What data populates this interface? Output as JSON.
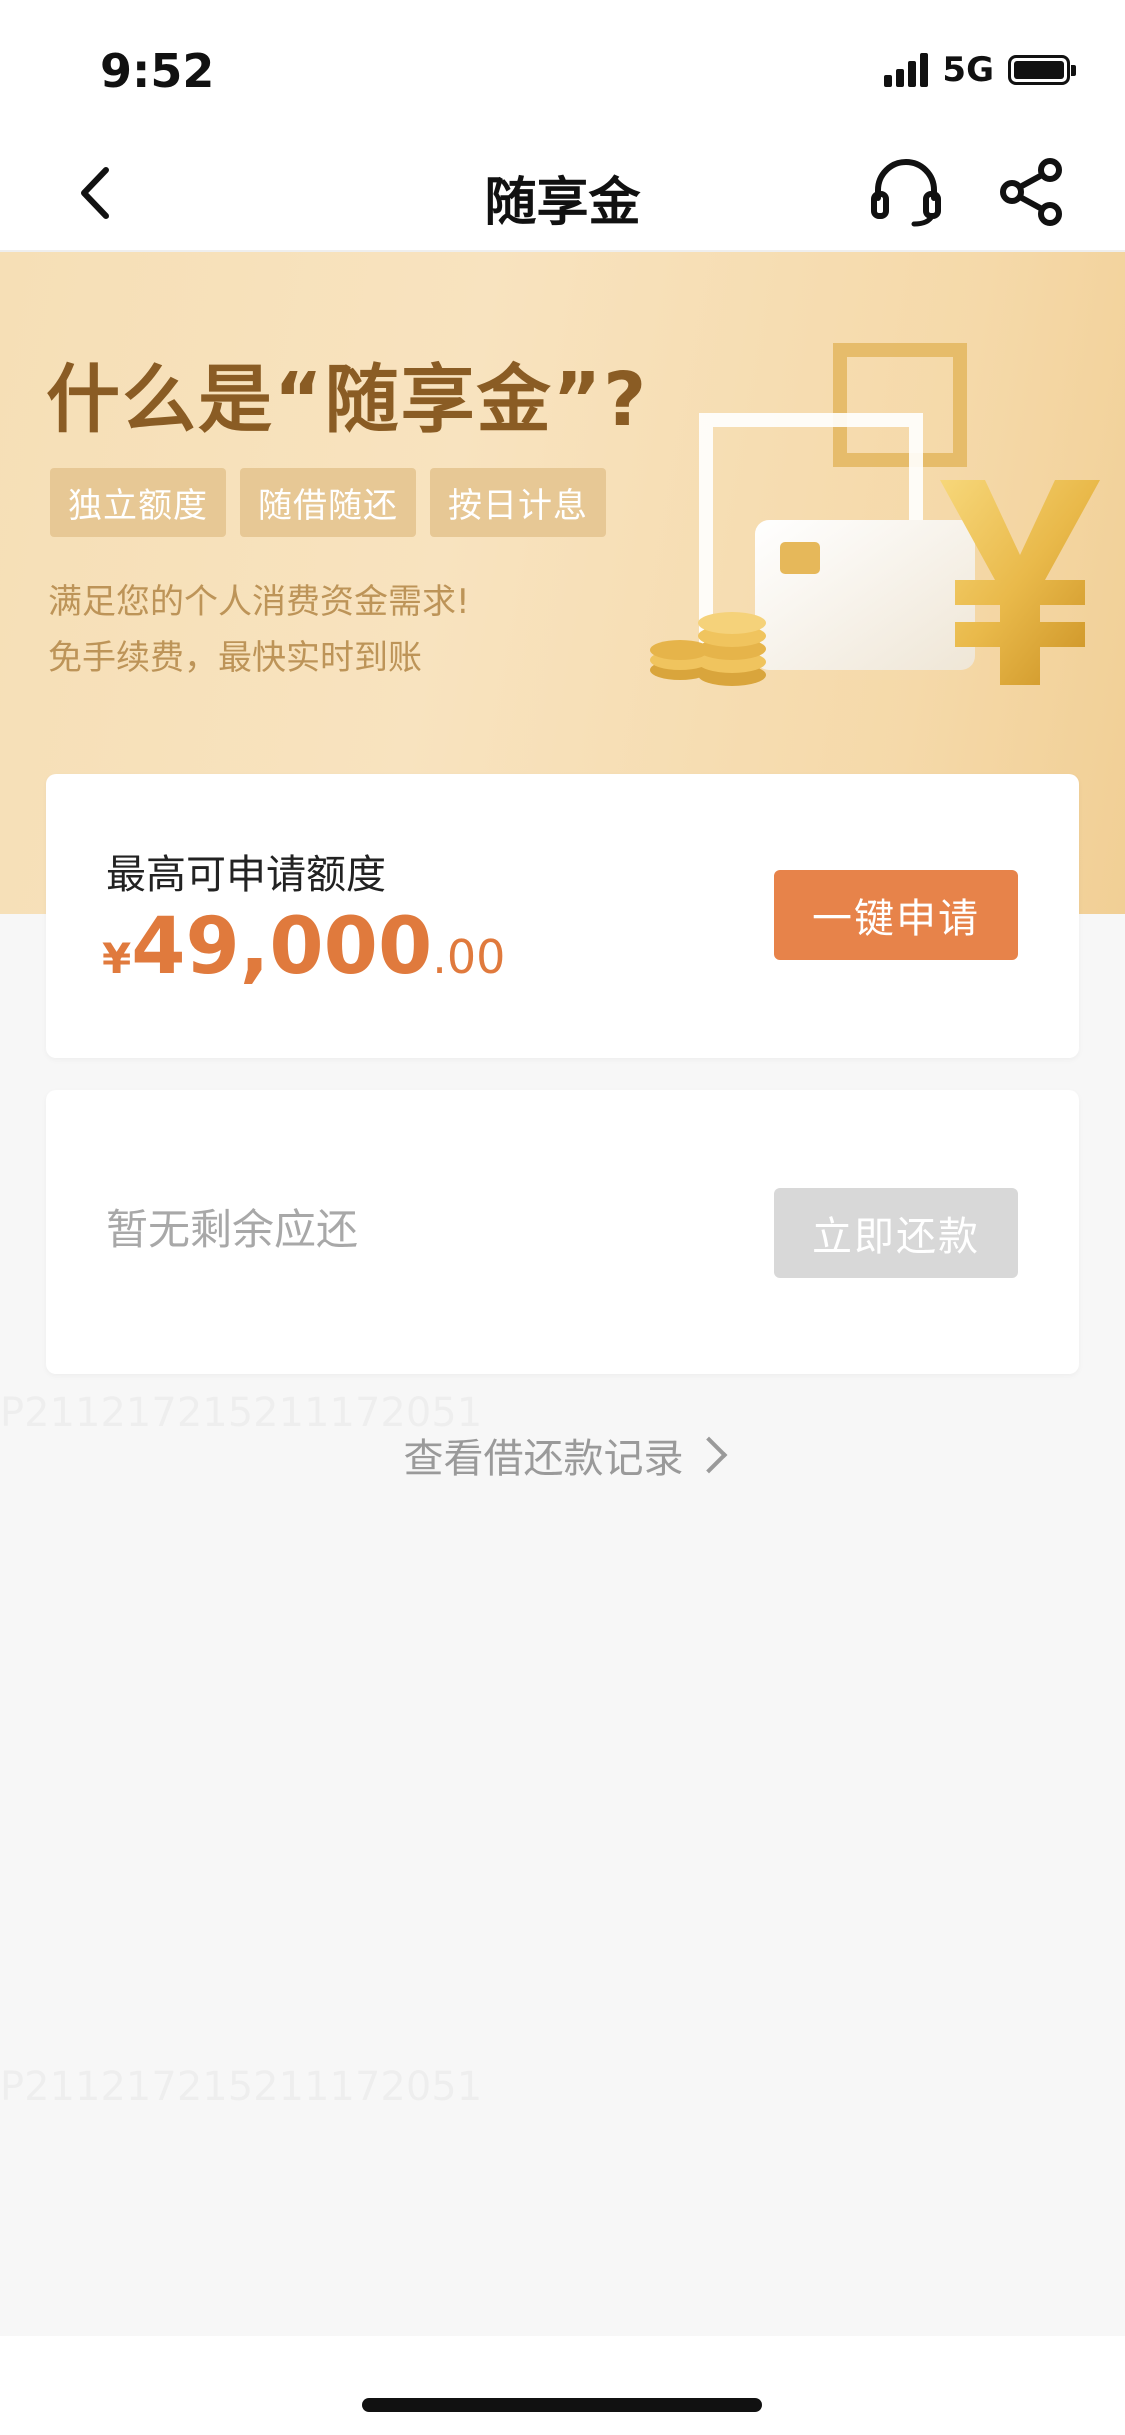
{
  "status_bar": {
    "time": "9:52",
    "network": "5G",
    "icons": [
      "signal-icon",
      "battery-icon"
    ]
  },
  "nav": {
    "title": "随享金",
    "icons": [
      "back-icon",
      "headset-icon",
      "share-icon"
    ]
  },
  "banner": {
    "title": "什么是“随享金”?",
    "tags": [
      "独立额度",
      "随借随还",
      "按日计息"
    ],
    "desc_line1": "满足您的个人消费资金需求!",
    "desc_line2": "免手续费，最快实时到账",
    "art_icons": [
      "card-icon",
      "yen-icon",
      "coins-icon"
    ],
    "colors": {
      "title": "#8a5c24",
      "desc": "#bd9458",
      "tag_bg": "#e7c895"
    }
  },
  "credit_card": {
    "label": "最高可申请额度",
    "currency": "¥",
    "amount_integer": "49,000",
    "amount_decimal": ".00",
    "apply_label": "一键申请",
    "accent_color": "#e07a3d"
  },
  "repay_card": {
    "status": "暂无剩余应还",
    "repay_label": "立即还款"
  },
  "records_link": {
    "label": "查看借还款记录"
  },
  "watermark": {
    "text": "P211217215211172051"
  }
}
